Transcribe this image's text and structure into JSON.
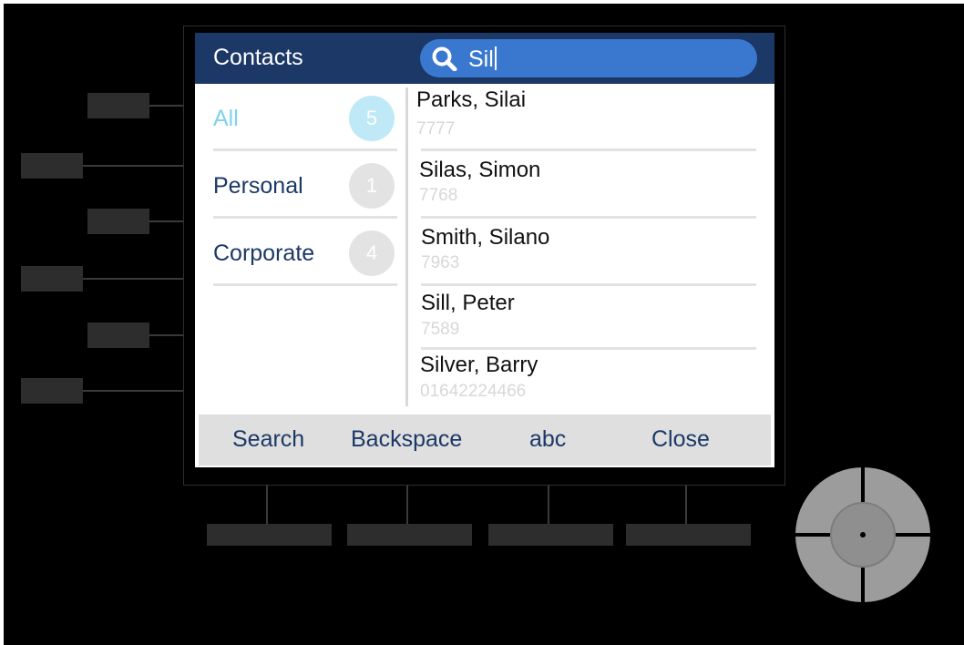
{
  "header": {
    "title": "Contacts",
    "search": {
      "value": "Sil",
      "icon": "search-icon"
    }
  },
  "categories": [
    {
      "label": "All",
      "count": "5",
      "active": true
    },
    {
      "label": "Personal",
      "count": "1",
      "active": false
    },
    {
      "label": "Corporate",
      "count": "4",
      "active": false
    }
  ],
  "contacts": [
    {
      "name": "Parks, Silai",
      "number": "7777"
    },
    {
      "name": "Silas, Simon",
      "number": "7768"
    },
    {
      "name": "Smith, Silano",
      "number": "7963"
    },
    {
      "name": "Sill, Peter",
      "number": "7589"
    },
    {
      "name": "Silver, Barry",
      "number": "01642224466"
    }
  ],
  "footer": {
    "search_label": "Search",
    "backspace_label": "Backspace",
    "abc_label": "abc",
    "close_label": "Close"
  },
  "colors": {
    "header_bg": "#1b3866",
    "search_bg": "#3a78d0",
    "active_category": "#7fd2ec",
    "text_primary": "#1b3866",
    "number_text": "#d8d8d8"
  }
}
